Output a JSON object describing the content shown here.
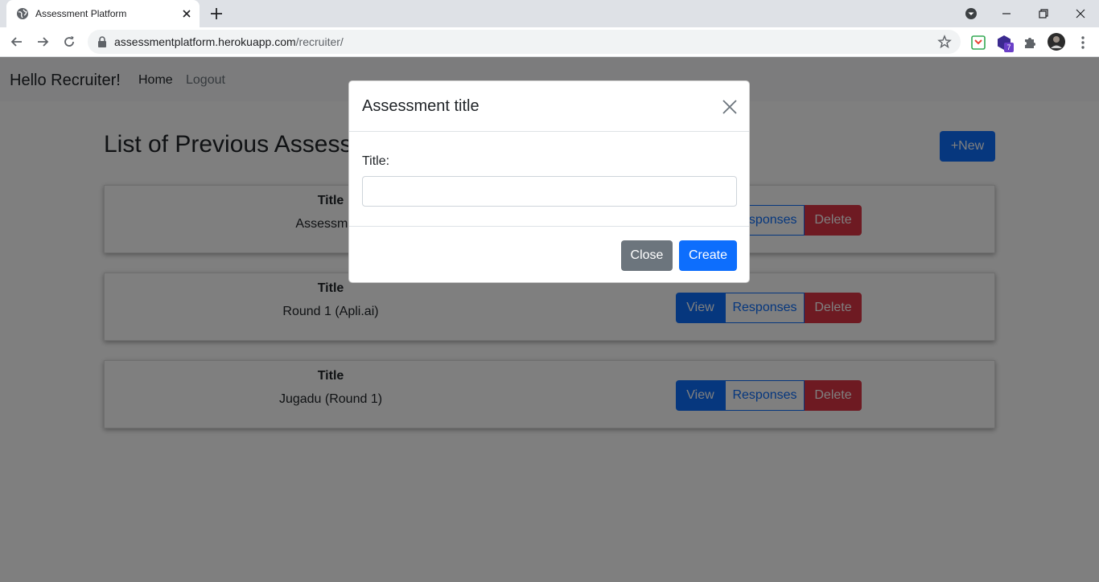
{
  "browser": {
    "tab_title": "Assessment Platform",
    "url_host": "assessmentplatform.herokuapp.com",
    "url_path": "/recruiter/",
    "extension_badge": "7"
  },
  "navbar": {
    "brand": "Hello Recruiter!",
    "links": [
      "Home",
      "Logout"
    ]
  },
  "main": {
    "heading": "List of Previous Assessments",
    "new_button": "+New",
    "card_label": "Title",
    "actions": {
      "view": "View",
      "responses": "Responses",
      "delete": "Delete"
    },
    "assessments": [
      {
        "title": "Assessment"
      },
      {
        "title": "Round 1 (Apli.ai)"
      },
      {
        "title": "Jugadu (Round 1)"
      }
    ]
  },
  "modal": {
    "title": "Assessment title",
    "field_label": "Title:",
    "input_value": "",
    "close_button": "Close",
    "create_button": "Create"
  },
  "colors": {
    "primary": "#0d6efd",
    "danger": "#dc3545",
    "secondary": "#6c757d",
    "backdrop": "rgba(0,0,0,0.5)"
  }
}
